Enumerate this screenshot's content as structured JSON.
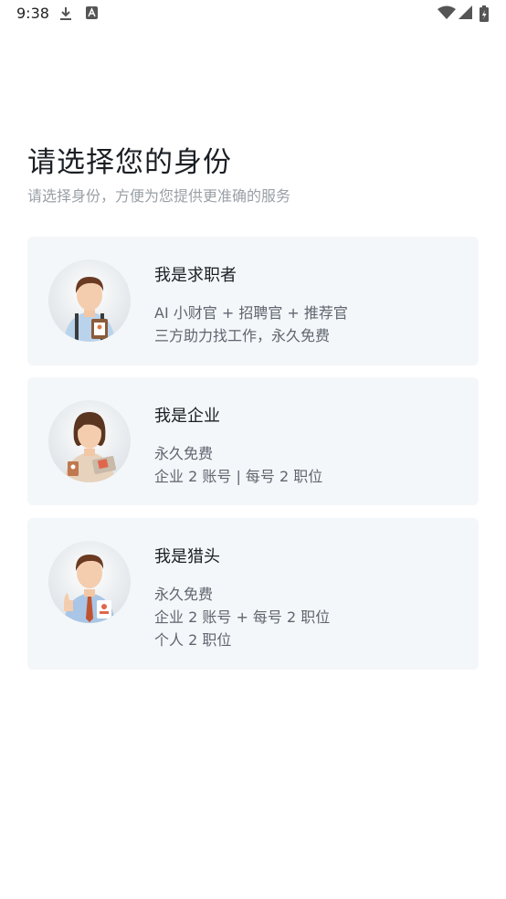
{
  "status_bar": {
    "time": "9:38",
    "left_icons": [
      "download-icon",
      "app-a-icon"
    ],
    "right_icons": [
      "wifi-icon",
      "signal-icon",
      "battery-charging-icon"
    ]
  },
  "header": {
    "title": "请选择您的身份",
    "subtitle": "请选择身份，方便为您提供更准确的服务"
  },
  "roles": [
    {
      "title": "我是求职者",
      "lines": [
        "AI 小财官 + 招聘官 + 推荐官",
        "三方助力找工作，永久免费"
      ],
      "avatar": "job-seeker-avatar"
    },
    {
      "title": "我是企业",
      "lines": [
        "永久免费",
        "企业 2 账号 | 每号 2 职位"
      ],
      "avatar": "enterprise-avatar"
    },
    {
      "title": "我是猎头",
      "lines": [
        "永久免费",
        "企业 2 账号 + 每号 2 职位",
        "个人 2 职位"
      ],
      "avatar": "headhunter-avatar"
    }
  ],
  "colors": {
    "card_background": "#f4f7f9",
    "title_text": "#1b1f24",
    "secondary_text": "#5f6670",
    "subtitle_text": "#9aa0a6"
  }
}
